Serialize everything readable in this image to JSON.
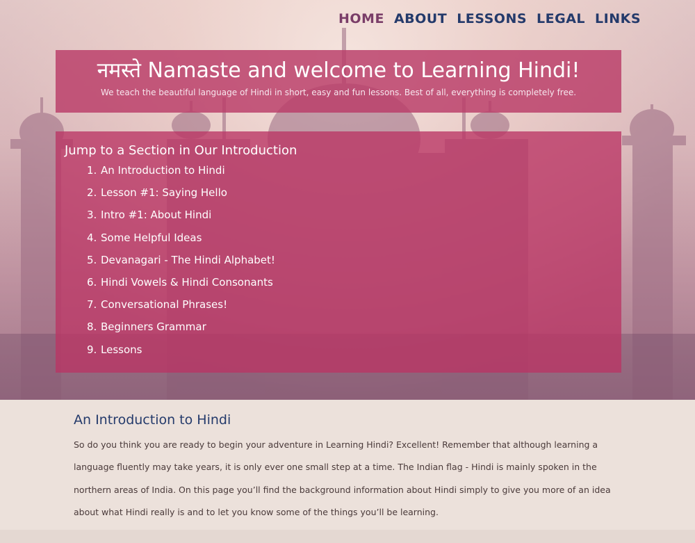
{
  "nav": {
    "items": [
      "HOME",
      "ABOUT",
      "LESSONS",
      "LEGAL",
      "LINKS"
    ],
    "active": "HOME"
  },
  "welcome": {
    "title": "नमस्ते Namaste and welcome to Learning Hindi!",
    "subtitle": "We teach the beautiful language of Hindi in short, easy and fun lessons. Best of all, everything is completely free."
  },
  "toc": {
    "heading": "Jump to a Section in Our Introduction",
    "items": [
      {
        "num": "1.",
        "label": "An Introduction to Hindi"
      },
      {
        "num": "2.",
        "label": "Lesson #1: Saying Hello"
      },
      {
        "num": "3.",
        "label": "Intro #1: About Hindi"
      },
      {
        "num": "4.",
        "label": "Some Helpful Ideas"
      },
      {
        "num": "5.",
        "label": "Devanagari - The Hindi Alphabet!"
      },
      {
        "num": "6.",
        "label": "Hindi Vowels & Hindi Consonants"
      },
      {
        "num": "7.",
        "label": "Conversational Phrases!"
      },
      {
        "num": "8.",
        "label": "Beginners Grammar"
      },
      {
        "num": "9.",
        "label": "Lessons"
      }
    ]
  },
  "intro": {
    "heading": "An Introduction to Hindi",
    "body": "So do you think you are ready to begin your adventure in Learning Hindi? Excellent! Remember that although learning a language fluently may take years, it is only ever one small step at a time. The Indian flag - Hindi is mainly spoken in the northern areas of India. On this page you’ll find the background information about Hindi simply to give you more of an idea about what Hindi really is and to let you know some of the things you’ll be learning."
  },
  "colors": {
    "nav_text": "#243a6b",
    "nav_active": "#7a3d68",
    "panel": "#ba3c68",
    "page_bg": "#ece1db"
  }
}
